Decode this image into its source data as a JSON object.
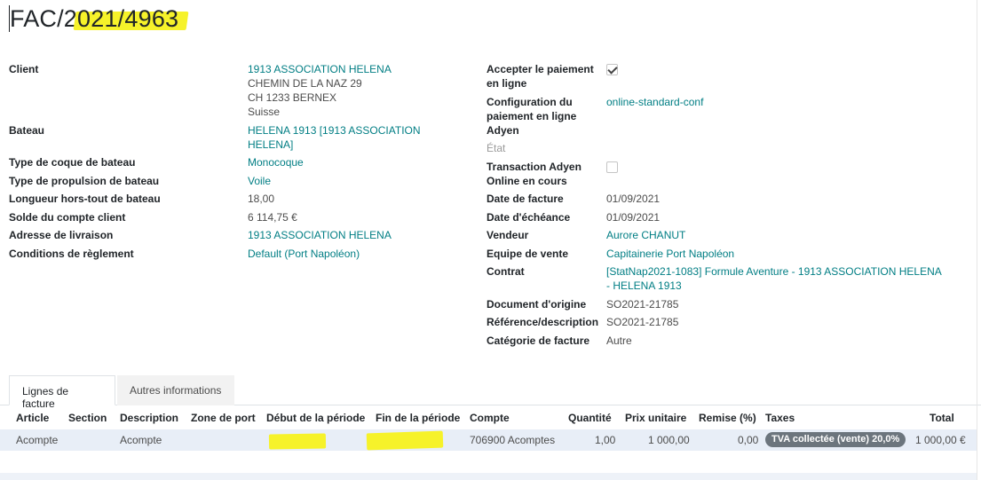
{
  "title": {
    "prefix": "FAC/2",
    "highlighted": "021/4963"
  },
  "left_fields": [
    {
      "label": "Client",
      "lines": [
        "1913 ASSOCIATION HELENA",
        "CHEMIN DE LA NAZ 29",
        "CH 1233 BERNEX",
        "Suisse"
      ]
    },
    {
      "label": "Bateau",
      "lines": [
        "HELENA 1913 [1913 ASSOCIATION",
        "HELENA]"
      ]
    },
    {
      "label": "Type de coque de bateau",
      "value": "Monocoque"
    },
    {
      "label": "Type de propulsion de bateau",
      "value": "Voile"
    },
    {
      "label": "Longueur hors-tout de bateau",
      "value": "18,00"
    },
    {
      "label": "Solde du compte client",
      "value": "6 114,75 €"
    },
    {
      "label": "Adresse de livraison",
      "value": "1913 ASSOCIATION HELENA"
    },
    {
      "label": "Conditions de règlement",
      "value": "Default (Port Napoléon)"
    }
  ],
  "right_fields": [
    {
      "label_lines": [
        "Accepter le paiement",
        "en ligne"
      ]
    },
    {
      "label_lines": [
        "Configuration du",
        "paiement en ligne",
        "Adyen"
      ],
      "value": "online-standard-conf"
    },
    {
      "label": "État"
    },
    {
      "label_lines": [
        "Transaction Adyen",
        "Online en cours"
      ]
    },
    {
      "label": "Date de facture",
      "value": "01/09/2021"
    },
    {
      "label": "Date d'échéance",
      "value": "01/09/2021"
    },
    {
      "label": "Vendeur",
      "value": "Aurore CHANUT"
    },
    {
      "label": "Equipe de vente",
      "value": "Capitainerie Port Napoléon"
    },
    {
      "label": "Contrat",
      "lines": [
        "[StatNap2021-1083] Formule Aventure - 1913 ASSOCIATION HELENA",
        "- HELENA 1913"
      ]
    },
    {
      "label": "Document d'origine",
      "value": "SO2021-21785"
    },
    {
      "label": "Référence/description",
      "value": "SO2021-21785"
    },
    {
      "label": "Catégorie de facture",
      "value": "Autre"
    }
  ],
  "tabs": [
    "Lignes de facture",
    "Autres informations"
  ],
  "table": {
    "headers": [
      "Article",
      "Section",
      "Description",
      "Zone de port",
      "Début de la période",
      "Fin de la période",
      "Compte",
      "Quantité",
      "Prix unitaire",
      "Remise (%)",
      "Taxes",
      "Total"
    ],
    "row": {
      "article": "Acompte",
      "description": "Acompte",
      "compte": "706900 Acomptes",
      "quantite": "1,00",
      "prix": "1 000,00",
      "remise": "0,00",
      "taxe": "TVA collectée (vente) 20,0%",
      "total": "1 000,00 €"
    }
  },
  "colors": {
    "link": "#017e84",
    "highlight": "#f6f22a",
    "badge": "#6c757d",
    "row": "#e8eef7"
  }
}
